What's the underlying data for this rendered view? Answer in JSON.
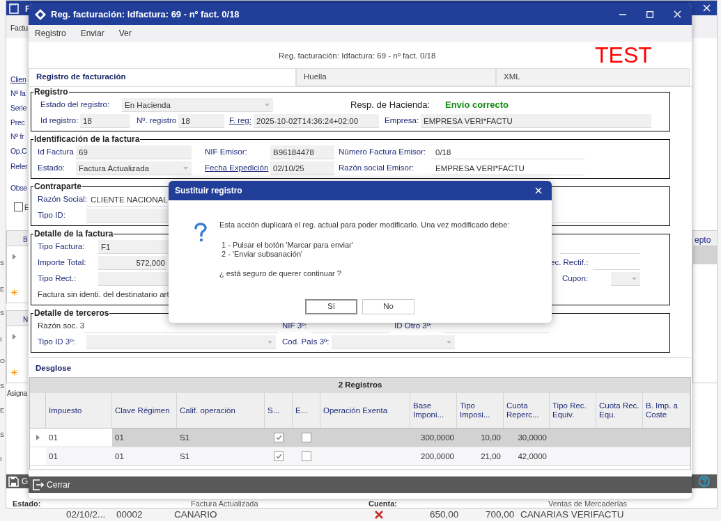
{
  "background_window": {
    "title": "F",
    "menu": "Factu",
    "fields": [
      {
        "kind": "link",
        "text": "Clien"
      },
      {
        "kind": "label",
        "text": "Nº fa"
      },
      {
        "kind": "label",
        "text": "Serie"
      },
      {
        "kind": "label",
        "text": "Prec"
      },
      {
        "kind": "label",
        "text": "Nº fr"
      },
      {
        "kind": "label",
        "text": "Op.C"
      },
      {
        "kind": "label",
        "text": "Refer"
      },
      {
        "kind": "label",
        "text": "Obse"
      }
    ],
    "checkbox": {
      "label": "E",
      "checked": false
    },
    "grid_headers": [
      "B",
      "N"
    ],
    "side_text": "Asigna",
    "right_column_header": "epto",
    "toolbar_button": "G",
    "status": [
      {
        "label": "Estado:",
        "value": "Factura Actualizada"
      },
      {
        "label": "Cuenta:",
        "value": "Ventas de Mercaderías"
      }
    ]
  },
  "left_strip": [
    "S",
    "E",
    "S",
    "I",
    "O",
    "S",
    "E",
    "S",
    "I"
  ],
  "bottom_row": [
    "02/10/2...",
    "00002",
    "CANARIO",
    "650,00",
    "700,00",
    "CANARIAS VERIFACTU"
  ],
  "window": {
    "title": "Reg. facturación: Idfactura: 69 - nº fact. 0/18",
    "menu": [
      "Registro",
      "Enviar",
      "Ver"
    ],
    "heading": "Reg. facturación: Idfactura: 69 - nº fact. 0/18",
    "badge": "TEST",
    "tabs": [
      {
        "label": "Registro de facturación",
        "selected": true
      },
      {
        "label": "Huella",
        "selected": false
      },
      {
        "label": "XML",
        "selected": false
      }
    ],
    "sections": [
      {
        "legend": "Registro",
        "rows": [
          {
            "items": [
              {
                "kind": "label",
                "text": "Estado del registro:"
              },
              {
                "kind": "select",
                "value": "En Hacienda"
              },
              {
                "kind": "caption",
                "text": "Resp. de Hacienda:"
              },
              {
                "kind": "status",
                "text": "Envío correcto"
              }
            ]
          },
          {
            "items": [
              {
                "kind": "label",
                "text": "Id registro:"
              },
              {
                "kind": "field",
                "value": "18"
              },
              {
                "kind": "label",
                "text": "Nº. registro"
              },
              {
                "kind": "field",
                "value": "18"
              },
              {
                "kind": "link",
                "text": "F. reg:"
              },
              {
                "kind": "field",
                "value": "2025-10-02T14:36:24+02:00"
              },
              {
                "kind": "label",
                "text": "Empresa:"
              },
              {
                "kind": "field",
                "value": "EMPRESA VERI*FACTU"
              }
            ]
          }
        ]
      },
      {
        "legend": "Identificación de la factura",
        "rows": [
          {
            "items": [
              {
                "kind": "label",
                "text": "Id Factura"
              },
              {
                "kind": "field",
                "value": "69"
              },
              {
                "kind": "label",
                "text": "NIF Emisor:"
              },
              {
                "kind": "field",
                "value": "B96184478"
              },
              {
                "kind": "label",
                "text": "Número Factura Emisor:"
              },
              {
                "kind": "line",
                "value": "0/18"
              }
            ]
          },
          {
            "items": [
              {
                "kind": "label",
                "text": "Estado:"
              },
              {
                "kind": "select",
                "value": "Factura Actualizada"
              },
              {
                "kind": "link",
                "text": "Fecha Expedición"
              },
              {
                "kind": "field",
                "value": "02/10/25"
              },
              {
                "kind": "label",
                "text": "Razón social Emisor:"
              },
              {
                "kind": "line",
                "value": "EMPRESA VERI*FACTU"
              }
            ]
          }
        ]
      },
      {
        "legend": "Contraparte",
        "rows": [
          {
            "items": [
              {
                "kind": "label",
                "text": "Razón Social:"
              },
              {
                "kind": "line",
                "value": "CLIENTE NACIONAL"
              }
            ]
          },
          {
            "items": [
              {
                "kind": "label",
                "text": "Tipo ID:"
              },
              {
                "kind": "field"
              },
              {
                "kind": "line"
              }
            ]
          }
        ]
      },
      {
        "legend": "Detalle de la factura",
        "rows": [
          {
            "items": [
              {
                "kind": "label",
                "text": "Tipo Factura:"
              },
              {
                "kind": "field",
                "value": "F1"
              },
              {
                "kind": "line"
              }
            ]
          },
          {
            "items": [
              {
                "kind": "label",
                "text": "Importe Total:"
              },
              {
                "kind": "number",
                "value": "572,000"
              },
              {
                "kind": "label",
                "text": "ec. Rectif.:"
              },
              {
                "kind": "line"
              }
            ]
          },
          {
            "items": [
              {
                "kind": "label",
                "text": "Tipo Rect.:"
              },
              {
                "kind": "field"
              },
              {
                "kind": "label",
                "text": "Cupon:"
              },
              {
                "kind": "select"
              }
            ]
          },
          {
            "items": [
              {
                "kind": "note",
                "text": "Factura sin identi. del destinatario art"
              }
            ]
          }
        ]
      },
      {
        "legend": "Detalle de terceros",
        "rows": [
          {
            "items": [
              {
                "kind": "note",
                "text": "Razón soc. 3"
              },
              {
                "kind": "line"
              },
              {
                "kind": "label",
                "text": "NIF 3º:"
              },
              {
                "kind": "line"
              },
              {
                "kind": "label",
                "text": "ID Otro 3º:"
              },
              {
                "kind": "line"
              }
            ]
          },
          {
            "items": [
              {
                "kind": "label",
                "text": "Tipo ID 3º:"
              },
              {
                "kind": "select"
              },
              {
                "kind": "label",
                "text": "Cod. País 3º:"
              },
              {
                "kind": "select"
              }
            ]
          }
        ]
      }
    ],
    "desglose": {
      "title": "Desglose",
      "count": "2 Registros",
      "columns": [
        {
          "label": "Impuesto",
          "kind": "text"
        },
        {
          "label": "Clave Régimen",
          "kind": "text"
        },
        {
          "label": "Calif. operación",
          "kind": "text"
        },
        {
          "label": "S...",
          "kind": "check"
        },
        {
          "label": "E...",
          "kind": "check"
        },
        {
          "label": "Operación Exenta",
          "kind": "text"
        },
        {
          "label": "Base Imponi...",
          "kind": "number"
        },
        {
          "label": "Tipo Imposi...",
          "kind": "number"
        },
        {
          "label": "Cuota Reperc...",
          "kind": "number"
        },
        {
          "label": "Tipo Rec. Equiv.",
          "kind": "number"
        },
        {
          "label": "Cuota Rec. Equ.",
          "kind": "number"
        },
        {
          "label": "B. Imp. a Coste",
          "kind": "number"
        }
      ],
      "rows": [
        {
          "selected": true,
          "cells": [
            "01",
            "01",
            "S1",
            true,
            false,
            null,
            "300,0000",
            "10,00",
            "30,0000",
            null,
            null,
            null
          ]
        },
        {
          "selected": false,
          "cells": [
            "01",
            "01",
            "S1",
            true,
            false,
            null,
            "200,0000",
            "21,00",
            "42,0000",
            null,
            null,
            null
          ]
        }
      ]
    },
    "footer": {
      "close": "Cerrar"
    }
  },
  "dialog": {
    "title": "Sustituir registro",
    "message": "Esta acción duplicará el reg. actual para poder modificarlo. Una vez modificado debe:",
    "steps": [
      "1 - Pulsar el botón 'Marcar para enviar'",
      "2 - 'Enviar subsanación'"
    ],
    "question": "¿ está seguro de querer continuar ?",
    "buttons": [
      {
        "label": "Sí",
        "selected": true
      },
      {
        "label": "No",
        "selected": false
      }
    ]
  }
}
